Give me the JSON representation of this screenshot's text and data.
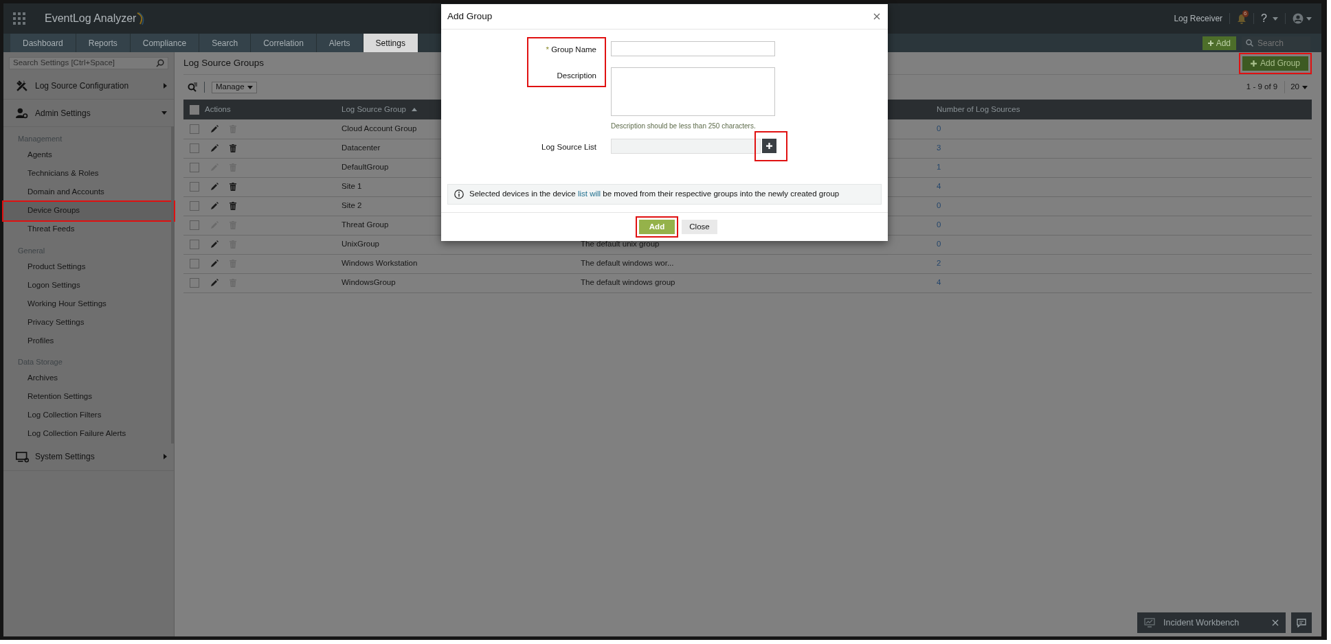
{
  "app": {
    "name": "EventLog Analyzer"
  },
  "header": {
    "log_receiver": "Log Receiver",
    "notification_count": "6",
    "help": "?"
  },
  "tabs": [
    {
      "label": "Dashboard",
      "selected": false
    },
    {
      "label": "Reports",
      "selected": false
    },
    {
      "label": "Compliance",
      "selected": false
    },
    {
      "label": "Search",
      "selected": false
    },
    {
      "label": "Correlation",
      "selected": false
    },
    {
      "label": "Alerts",
      "selected": false
    },
    {
      "label": "Settings",
      "selected": true
    }
  ],
  "quick_add": {
    "label": "Add"
  },
  "global_search": {
    "placeholder": "Search"
  },
  "sidebar": {
    "search_placeholder": "Search Settings [Ctrl+Space]",
    "sections": [
      {
        "label": "Log Source Configuration",
        "kind": "tools",
        "expanded": false
      },
      {
        "label": "Admin Settings",
        "kind": "admin",
        "expanded": true,
        "groups": [
          {
            "heading": "Management",
            "items": [
              {
                "label": "Agents",
                "selected": false,
                "highlighted": false
              },
              {
                "label": "Technicians & Roles",
                "selected": false,
                "highlighted": false
              },
              {
                "label": "Domain and Accounts",
                "selected": false,
                "highlighted": false
              },
              {
                "label": "Device Groups",
                "selected": true,
                "highlighted": true
              },
              {
                "label": "Threat Feeds",
                "selected": false,
                "highlighted": false
              }
            ]
          },
          {
            "heading": "General",
            "items": [
              {
                "label": "Product Settings",
                "selected": false,
                "highlighted": false
              },
              {
                "label": "Logon Settings",
                "selected": false,
                "highlighted": false
              },
              {
                "label": "Working Hour Settings",
                "selected": false,
                "highlighted": false
              },
              {
                "label": "Privacy Settings",
                "selected": false,
                "highlighted": false
              },
              {
                "label": "Profiles",
                "selected": false,
                "highlighted": false
              }
            ]
          },
          {
            "heading": "Data Storage",
            "items": [
              {
                "label": "Archives",
                "selected": false,
                "highlighted": false
              },
              {
                "label": "Retention Settings",
                "selected": false,
                "highlighted": false
              },
              {
                "label": "Log Collection Filters",
                "selected": false,
                "highlighted": false
              },
              {
                "label": "Log Collection Failure Alerts",
                "selected": false,
                "highlighted": false
              }
            ]
          }
        ]
      },
      {
        "label": "System Settings",
        "kind": "system",
        "expanded": false
      }
    ]
  },
  "page": {
    "title": "Log Source Groups",
    "add_button": {
      "label": "Add Group",
      "highlighted": true
    },
    "manage": "Manage",
    "pagination": "1 - 9 of 9",
    "page_size": "20"
  },
  "table": {
    "select_all_checked": false,
    "columns": [
      {
        "label": "Actions",
        "sorted": false
      },
      {
        "label": "Log Source Group",
        "sorted": true
      },
      {
        "label": "Number of Log Sources",
        "sorted": false
      }
    ],
    "rows": [
      {
        "checked": false,
        "can_edit": true,
        "can_delete": false,
        "group": "Cloud Account Group",
        "count": "0"
      },
      {
        "checked": false,
        "can_edit": true,
        "can_delete": true,
        "group": "Datacenter",
        "count": "3"
      },
      {
        "checked": false,
        "can_edit": false,
        "can_delete": false,
        "group": "DefaultGroup",
        "count": "1"
      },
      {
        "checked": false,
        "can_edit": true,
        "can_delete": true,
        "group": "Site 1",
        "count": "4"
      },
      {
        "checked": false,
        "can_edit": true,
        "can_delete": true,
        "group": "Site 2",
        "count": "0"
      },
      {
        "checked": false,
        "can_edit": false,
        "can_delete": false,
        "group": "Threat Group",
        "count": "0"
      },
      {
        "checked": false,
        "can_edit": true,
        "can_delete": false,
        "group": "UnixGroup",
        "description": "The default unix group",
        "count": "0"
      },
      {
        "checked": false,
        "can_edit": true,
        "can_delete": false,
        "group": "Windows Workstation",
        "description": "The default windows wor...",
        "count": "2"
      },
      {
        "checked": false,
        "can_edit": true,
        "can_delete": false,
        "group": "WindowsGroup",
        "description": "The default windows group",
        "count": "4"
      }
    ]
  },
  "modal": {
    "title": "Add Group",
    "fields": [
      {
        "label": "Group Name",
        "kind": "text",
        "marker": "*",
        "highlighted": true
      },
      {
        "label": "Description",
        "kind": "textarea",
        "highlighted": true,
        "hint": "Description should be less than 250 characters."
      },
      {
        "label": "Log Source List",
        "kind": "picker",
        "highlighted": true
      }
    ],
    "info": [
      {
        "text": "Selected devices in the device",
        "kind": "text"
      },
      {
        "text": "list will",
        "kind": "link"
      },
      {
        "text": "be moved from their respective groups into the newly created group",
        "kind": "text"
      }
    ],
    "buttons": [
      {
        "label": "Add",
        "kind": "primary",
        "highlighted": true
      },
      {
        "label": "Close",
        "kind": "secondary",
        "highlighted": false
      }
    ]
  },
  "incident_bar": {
    "label": "Incident Workbench"
  }
}
